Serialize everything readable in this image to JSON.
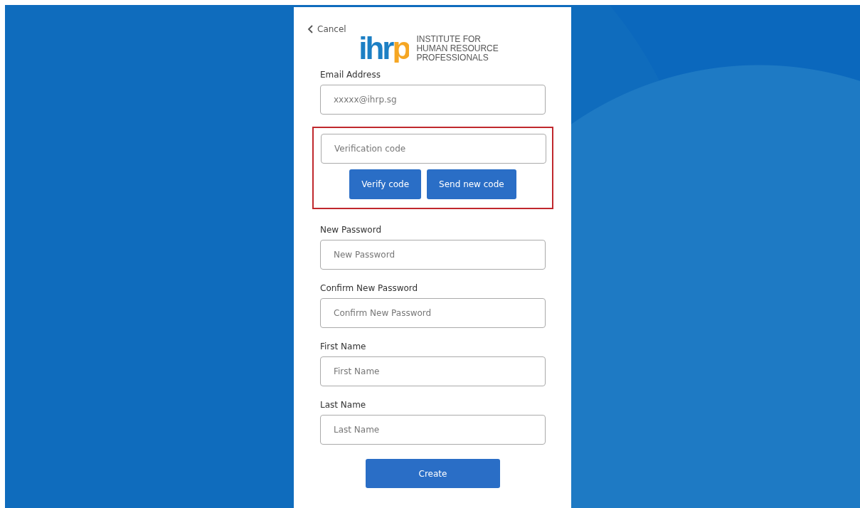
{
  "cancel": {
    "label": "Cancel"
  },
  "logo": {
    "mark": "ihrp",
    "name_lines": [
      "INSTITUTE FOR",
      "HUMAN RESOURCE",
      "PROFESSIONALS"
    ]
  },
  "sections": [
    {
      "kind": "field",
      "label": "Email Address",
      "placeholder": "xxxxx@ihrp.sg"
    },
    {
      "kind": "verification",
      "highlighted": true,
      "placeholder": "Verification code",
      "buttons": [
        "Verify code",
        "Send new code"
      ]
    },
    {
      "kind": "field",
      "label": "New Password",
      "placeholder": "New Password"
    },
    {
      "kind": "field",
      "label": "Confirm New Password",
      "placeholder": "Confirm New Password"
    },
    {
      "kind": "field",
      "label": "First Name",
      "placeholder": "First Name"
    },
    {
      "kind": "field",
      "label": "Last Name",
      "placeholder": "Last Name"
    }
  ],
  "submit": "Create"
}
